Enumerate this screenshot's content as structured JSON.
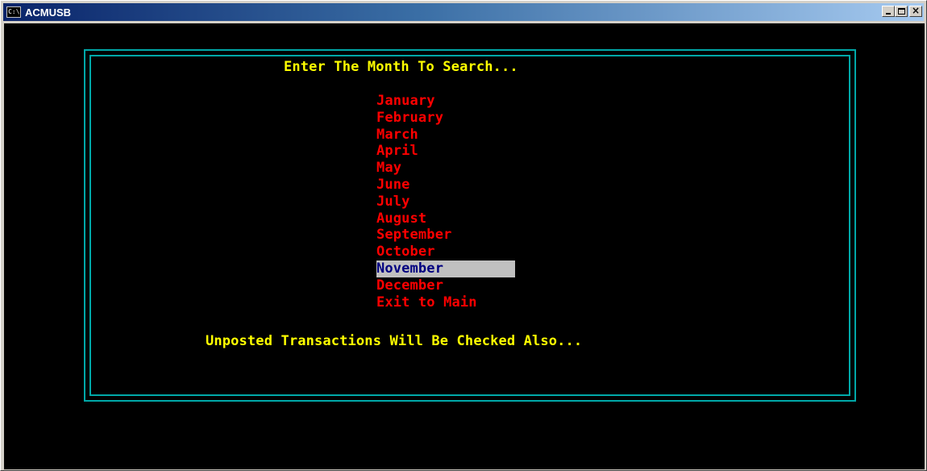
{
  "window": {
    "title": "ACMUSB",
    "icon": "console-icon",
    "icon_text": "C:\\"
  },
  "console": {
    "prompt": "Enter The Month To Search...",
    "menu": [
      {
        "label": "January",
        "selected": false
      },
      {
        "label": "February",
        "selected": false
      },
      {
        "label": "March",
        "selected": false
      },
      {
        "label": "April",
        "selected": false
      },
      {
        "label": "May",
        "selected": false
      },
      {
        "label": "June",
        "selected": false
      },
      {
        "label": "July",
        "selected": false
      },
      {
        "label": "August",
        "selected": false
      },
      {
        "label": "September",
        "selected": false
      },
      {
        "label": "October",
        "selected": false
      },
      {
        "label": "November",
        "selected": true
      },
      {
        "label": "December",
        "selected": false
      },
      {
        "label": "Exit to Main",
        "selected": false
      }
    ],
    "footer": "Unposted Transactions Will Be Checked Also..."
  },
  "colors": {
    "background": "#000000",
    "frame": "#00a8a8",
    "prompt_text": "#ffff00",
    "menu_text": "#ff0000",
    "selected_bg": "#c0c0c0",
    "selected_text": "#000080"
  }
}
